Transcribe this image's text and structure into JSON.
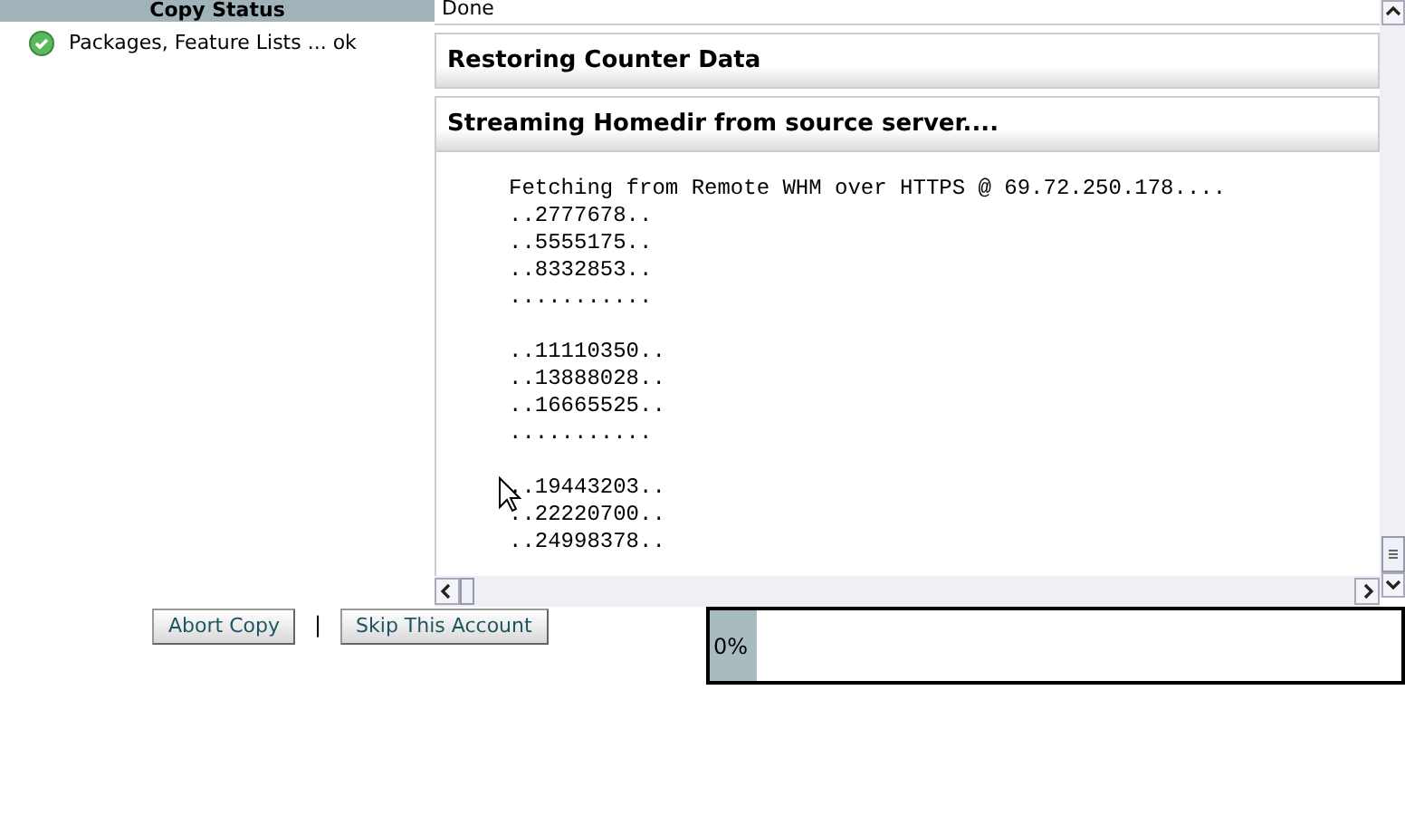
{
  "copy_status": {
    "title": "Copy Status",
    "items": [
      {
        "label": "Packages, Feature Lists ... ok",
        "succeeded": true
      }
    ]
  },
  "previous_step": {
    "text": "Done"
  },
  "sections": [
    {
      "title": "Restoring Counter Data"
    },
    {
      "title": "Streaming Homedir from source server...."
    }
  ],
  "log": {
    "blocks": [
      [
        "Fetching from Remote WHM over HTTPS @ 69.72.250.178....",
        "..2777678..",
        "..5555175..",
        "..8332853..",
        "..........."
      ],
      [
        "..11110350..",
        "..13888028..",
        "..16665525..",
        "..........."
      ],
      [
        "..19443203..",
        "..22220700..",
        "..24998378.."
      ]
    ]
  },
  "buttons": [
    {
      "label": "Abort Copy"
    },
    {
      "label": "Skip This Account"
    }
  ],
  "separator": "|",
  "progress": {
    "level": 0,
    "reading": "0%"
  }
}
